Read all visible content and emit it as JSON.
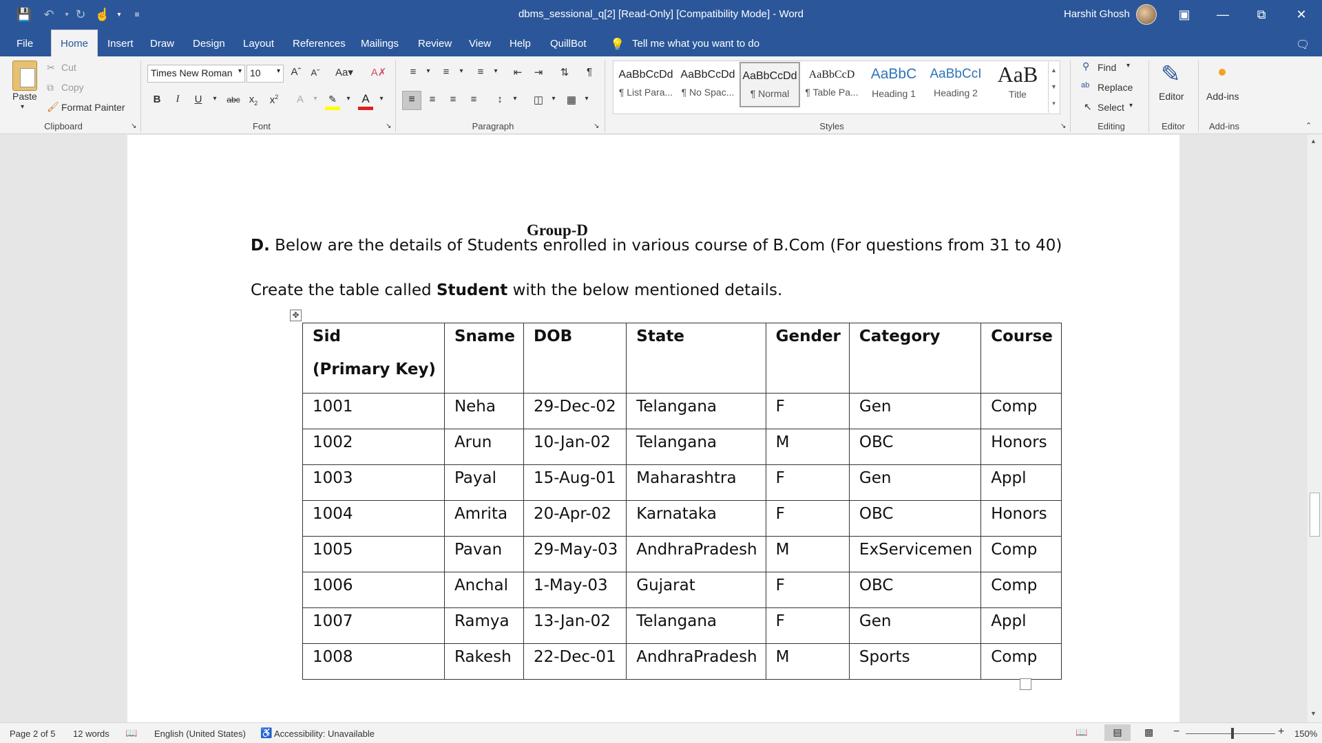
{
  "window": {
    "doc_title": "dbms_sessional_q[2] [Read-Only] [Compatibility Mode] - Word",
    "user_name": "Harshit Ghosh"
  },
  "tabs": [
    "File",
    "Home",
    "Insert",
    "Draw",
    "Design",
    "Layout",
    "References",
    "Mailings",
    "Review",
    "View",
    "Help",
    "QuillBot"
  ],
  "tell_me": "Tell me what you want to do",
  "clipboard": {
    "paste": "Paste",
    "cut": "Cut",
    "copy": "Copy",
    "format_painter": "Format Painter",
    "label": "Clipboard"
  },
  "font": {
    "name": "Times New Roman",
    "size": "10",
    "label": "Font"
  },
  "paragraph": {
    "label": "Paragraph"
  },
  "styles": {
    "label": "Styles",
    "items": [
      {
        "preview": "AaBbCcDd",
        "name": "¶ List Para..."
      },
      {
        "preview": "AaBbCcDd",
        "name": "¶ No Spac..."
      },
      {
        "preview": "AaBbCcDd",
        "name": "¶ Normal"
      },
      {
        "preview": "AaBbCcD",
        "name": "¶ Table Pa..."
      },
      {
        "preview": "AaBbC",
        "name": "Heading 1"
      },
      {
        "preview": "AaBbCcI",
        "name": "Heading 2"
      },
      {
        "preview": "AaB",
        "name": "Title"
      }
    ]
  },
  "editing": {
    "find": "Find",
    "replace": "Replace",
    "select": "Select",
    "label": "Editing"
  },
  "editor": {
    "button": "Editor",
    "label": "Editor"
  },
  "addins": {
    "button": "Add-ins",
    "label": "Add-ins"
  },
  "document": {
    "group_heading": "Group-D",
    "para1_bold": "D.",
    "para1": " Below are the details of Students enrolled in various course of B.Com (For questions from 31 to 40)",
    "para2_a": "Create the table called ",
    "para2_bold": "Student",
    "para2_b": " with the below mentioned details.",
    "table": {
      "headers": [
        "Sid",
        "Sname",
        "DOB",
        "State",
        "Gender",
        "Category",
        "Course"
      ],
      "header_sub": "(Primary Key)",
      "rows": [
        [
          "1001",
          "Neha",
          "29-Dec-02",
          "Telangana",
          "F",
          "Gen",
          "Comp"
        ],
        [
          "1002",
          "Arun",
          "10-Jan-02",
          "Telangana",
          "M",
          "OBC",
          "Honors"
        ],
        [
          "1003",
          "Payal",
          "15-Aug-01",
          "Maharashtra",
          "F",
          "Gen",
          "Appl"
        ],
        [
          "1004",
          "Amrita",
          "20-Apr-02",
          "Karnataka",
          "F",
          "OBC",
          "Honors"
        ],
        [
          "1005",
          "Pavan",
          "29-May-03",
          "AndhraPradesh",
          "M",
          "ExServicemen",
          "Comp"
        ],
        [
          "1006",
          "Anchal",
          "1-May-03",
          "Gujarat",
          "F",
          "OBC",
          "Comp"
        ],
        [
          "1007",
          "Ramya",
          "13-Jan-02",
          "Telangana",
          "F",
          "Gen",
          "Appl"
        ],
        [
          "1008",
          "Rakesh",
          "22-Dec-01",
          "AndhraPradesh",
          "M",
          "Sports",
          "Comp"
        ]
      ]
    }
  },
  "status": {
    "page": "Page 2 of 5",
    "words": "12 words",
    "language": "English (United States)",
    "accessibility": "Accessibility: Unavailable",
    "zoom": "150%"
  }
}
